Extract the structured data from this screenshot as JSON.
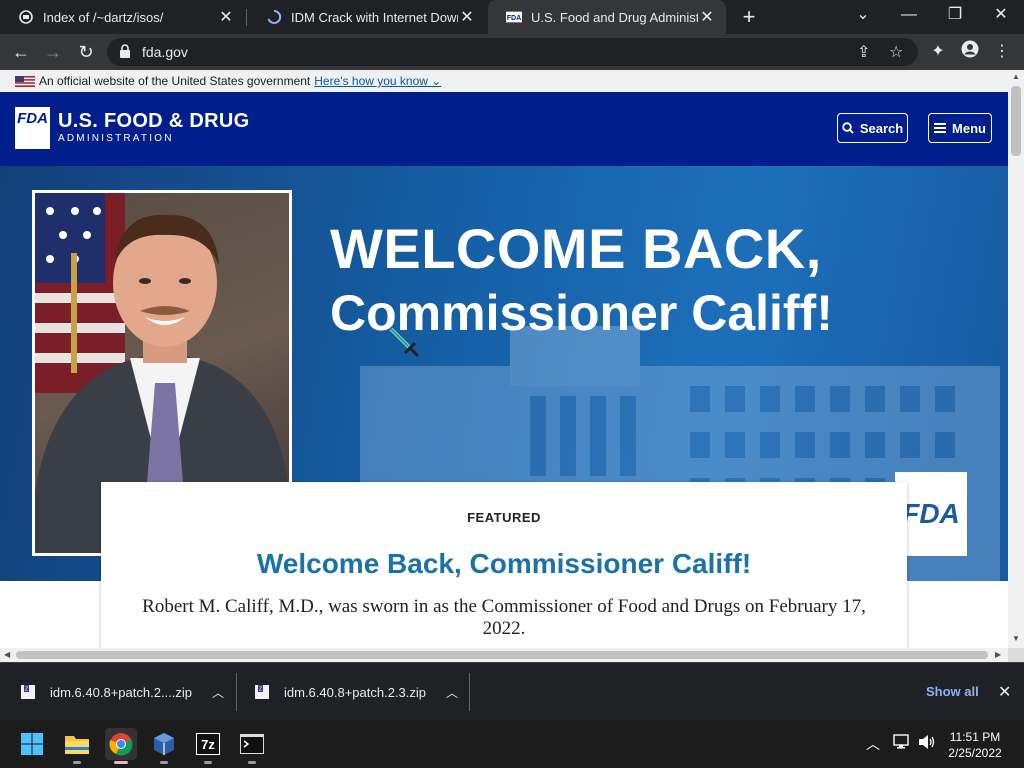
{
  "tabs": [
    {
      "title": "Index of /~dartz/isos/",
      "icon": "directory-icon"
    },
    {
      "title": "IDM Crack with Internet Downlo…",
      "icon": "loading-icon"
    },
    {
      "title": "U.S. Food and Drug Administrati…",
      "icon": "fda-favicon"
    }
  ],
  "window_controls": {
    "dropdown": "⌄",
    "minimize": "—",
    "restore": "❐",
    "close": "✕"
  },
  "address_bar": {
    "url": "fda.gov"
  },
  "gov_banner": {
    "text": "An official website of the United States government",
    "link": "Here's how you know ⌄"
  },
  "header": {
    "logo": "FDA",
    "title": "U.S. FOOD & DRUG",
    "subtitle": "ADMINISTRATION",
    "search_label": "Search",
    "menu_label": "Menu"
  },
  "hero": {
    "line1": "WELCOME BACK,",
    "line2": "Commissioner Califf!",
    "badge": "FDA"
  },
  "featured": {
    "label": "FEATURED",
    "title": "Welcome Back, Commissioner Califf!",
    "body": "Robert M. Califf, M.D., was sworn in as the Commissioner of Food and Drugs on February 17, 2022."
  },
  "downloads": {
    "items": [
      {
        "name": "idm.6.40.8+patch.2....zip"
      },
      {
        "name": "idm.6.40.8+patch.2.3.zip"
      }
    ],
    "show_all": "Show all"
  },
  "taskbar": {
    "apps": [
      "windows-start-icon",
      "file-explorer-icon",
      "chrome-icon",
      "virtualbox-icon",
      "7zip-icon",
      "terminal-icon"
    ],
    "time": "11:51 PM",
    "date": "2/25/2022"
  },
  "colors": {
    "fda_blue": "#001e8c",
    "featured_title": "#1a73a8",
    "show_all": "#8ab4f8"
  }
}
